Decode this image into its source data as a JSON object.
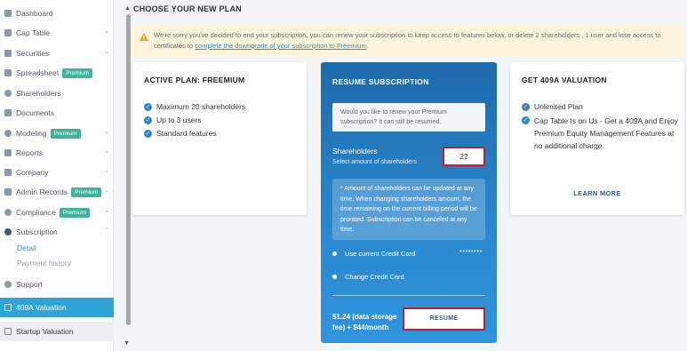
{
  "sidebar": {
    "items": [
      {
        "label": "Dashboard"
      },
      {
        "label": "Cap Table"
      },
      {
        "label": "Securities"
      },
      {
        "label": "Spreadsheet",
        "badge": "Premium"
      },
      {
        "label": "Shareholders"
      },
      {
        "label": "Documents"
      },
      {
        "label": "Modeling",
        "badge": "Premium"
      },
      {
        "label": "Reports"
      },
      {
        "label": "Company"
      },
      {
        "label": "Admin Records",
        "badge": "Premium"
      },
      {
        "label": "Compliance",
        "badge": "Premium"
      },
      {
        "label": "Subscription"
      },
      {
        "label": "Support"
      },
      {
        "label": "409A Valuation"
      },
      {
        "label": "Startup Valuation"
      }
    ],
    "subscription_sub": [
      {
        "label": "Detail"
      },
      {
        "label": "Payment history"
      }
    ]
  },
  "main": {
    "title": "CHOOSE YOUR NEW PLAN",
    "notice": {
      "text": "We're sorry you've decided to end your subscription, you can renew your subscription to keep access to features below, or delete 2 shareholders , 1 user and lose access to certificates to",
      "link": "complete the downgrade of your subscription to Freemium",
      "suffix": "."
    },
    "active_plan": {
      "title": "ACTIVE PLAN: FREEMIUM",
      "features": [
        "Maximum 20 shareholders",
        "Up to 3 users",
        "Standard features"
      ]
    },
    "resume": {
      "title": "RESUME SUBSCRIPTION",
      "question": "Would you like to renew your Premium subscription? It can still be resumed.",
      "shareholders_label": "Shareholders",
      "shareholders_sub": "Select amount of shareholders",
      "shareholders_value": "22",
      "info": "* Amount of shareholders can be updated at any time. When changing shareholders amount, the time remaining on the current billing period will be prorated. Subscription can be canceled at any time.",
      "use_card": "Use current Credit Card",
      "card_mask": "********",
      "change_card": "Change Credit Card",
      "price": "$1.24 (data storage fee) + $44/month",
      "button": "RESUME"
    },
    "valuation": {
      "title": "GET 409A VALUATION",
      "features": [
        "Unlimited Plan",
        "Cap Table Is on Us - Get a 409A and Enjoy Premium Equity Management Features at no additional charge"
      ],
      "link": "LEARN MORE"
    }
  },
  "colors": {
    "accent": "#2fa4d6",
    "badge": "#3fb39c",
    "highlight_border": "#c81e2b",
    "resume_card": "#2a86cb"
  }
}
